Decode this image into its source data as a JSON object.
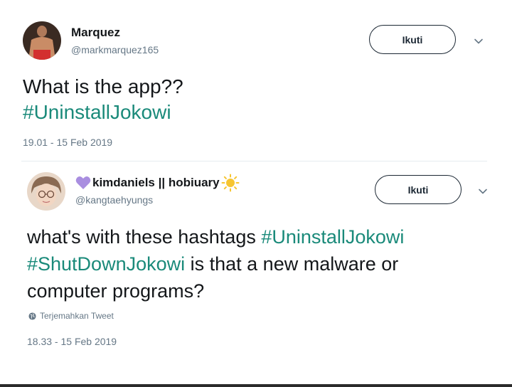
{
  "tweets": [
    {
      "display_name": "Marquez",
      "handle": "@markmarquez165",
      "follow_label": "Ikuti",
      "text_lines": [
        [
          {
            "t": "What is the app??",
            "tag": false
          }
        ],
        [
          {
            "t": "#UninstallJokowi",
            "tag": true
          }
        ]
      ],
      "timestamp": "19.01 - 15 Feb 2019"
    },
    {
      "display_name": "kimdaniels || hobiuary",
      "handle": "@kangtaehyungs",
      "follow_label": "Ikuti",
      "text_lines": [
        [
          {
            "t": "what's with these hashtags ",
            "tag": false
          },
          {
            "t": "#UninstallJokowi",
            "tag": true
          }
        ],
        [
          {
            "t": "#ShutDownJokowi",
            "tag": true
          },
          {
            "t": " is that a new malware or",
            "tag": false
          }
        ],
        [
          {
            "t": "computer programs?",
            "tag": false
          }
        ]
      ],
      "translate_label": "Terjemahkan Tweet",
      "timestamp": "18.33 - 15 Feb 2019"
    }
  ],
  "icons": {
    "name_prefix": "purple-heart-icon",
    "name_suffix": "sun-icon",
    "translate": "globe-icon",
    "menu": "chevron-down-icon"
  },
  "colors": {
    "hashtag": "#1a8a7a",
    "muted": "#657786",
    "text": "#14171a"
  }
}
